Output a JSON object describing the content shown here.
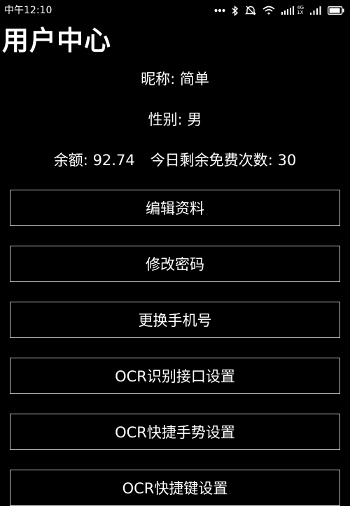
{
  "status_bar": {
    "time": "中午12:10",
    "network_top": "4G",
    "network_bottom": "1X",
    "icons": [
      "more-dots-icon",
      "bluetooth-icon",
      "do-not-disturb-icon",
      "wifi-icon",
      "signal-strength-icon",
      "signal-strength-icon",
      "battery-icon"
    ]
  },
  "header": {
    "title": "用户中心"
  },
  "profile": {
    "nickname_label": "昵称",
    "nickname": "简单",
    "gender_label": "性别",
    "gender": "男",
    "balance_label": "余额",
    "balance": "92.74",
    "free_count_label": "今日剩余免费次数",
    "free_count": "30",
    "separator": ": "
  },
  "actions": {
    "edit_profile": "编辑资料",
    "change_password": "修改密码",
    "change_phone": "更换手机号",
    "ocr_api_settings": "OCR识别接口设置",
    "ocr_gesture_settings": "OCR快捷手势设置",
    "ocr_hotkey_settings": "OCR快捷键设置"
  },
  "colors": {
    "background": "#000000",
    "text": "#ffffff",
    "button_border": "#bdbdbd"
  }
}
